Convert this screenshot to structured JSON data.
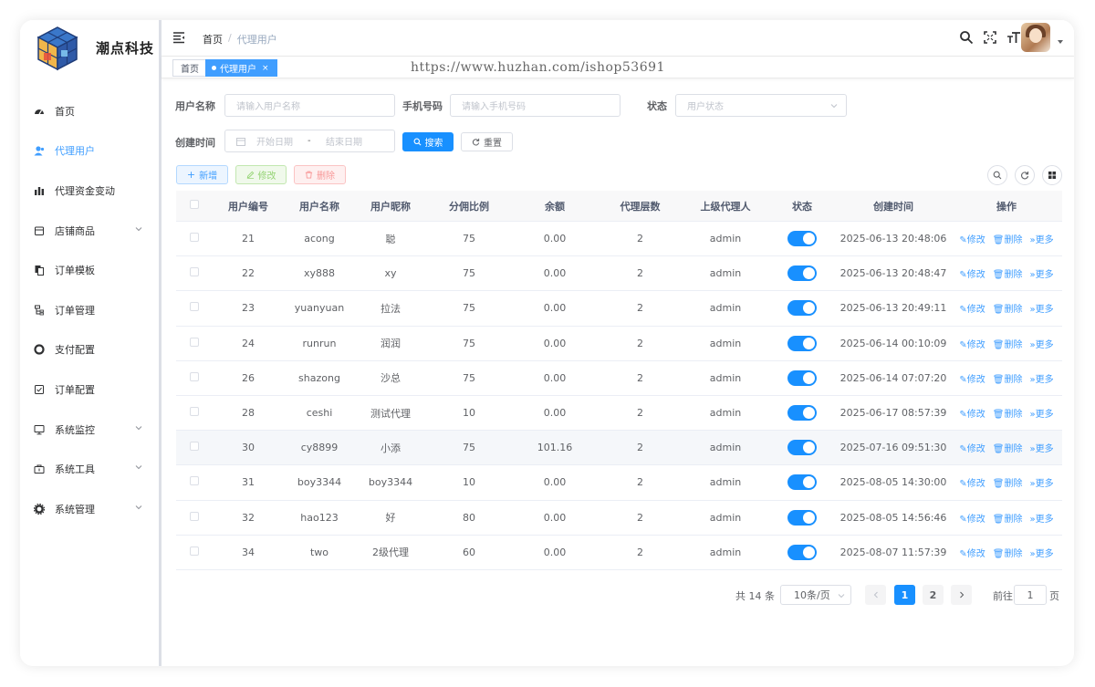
{
  "sidebar": {
    "brand": "潮点科技",
    "items": [
      {
        "label": "首页",
        "icon": "dashboard-icon"
      },
      {
        "label": "代理用户",
        "icon": "user-icon",
        "active": true
      },
      {
        "label": "代理资金变动",
        "icon": "bar-chart-icon"
      },
      {
        "label": "店铺商品",
        "icon": "shop-icon",
        "expandable": true
      },
      {
        "label": "订单模板",
        "icon": "copy-icon"
      },
      {
        "label": "订单管理",
        "icon": "tree-icon"
      },
      {
        "label": "支付配置",
        "icon": "circle-icon"
      },
      {
        "label": "订单配置",
        "icon": "checkbox-icon"
      },
      {
        "label": "系统监控",
        "icon": "monitor-icon",
        "expandable": true
      },
      {
        "label": "系统工具",
        "icon": "toolbox-icon",
        "expandable": true
      },
      {
        "label": "系统管理",
        "icon": "gear-icon",
        "expandable": true
      }
    ]
  },
  "header": {
    "breadcrumb_home": "首页",
    "breadcrumb_sep": "/",
    "breadcrumb_current": "代理用户"
  },
  "tags": {
    "home": "首页",
    "active": "代理用户",
    "close": "×"
  },
  "watermark": "https://www.huzhan.com/ishop53691",
  "search": {
    "username_label": "用户名称",
    "username_placeholder": "请输入用户名称",
    "phone_label": "手机号码",
    "phone_placeholder": "请输入手机号码",
    "status_label": "状态",
    "status_placeholder": "用户状态",
    "created_label": "创建时间",
    "start_placeholder": "开始日期",
    "range_sep": "-",
    "end_placeholder": "结束日期",
    "search_btn": "搜索",
    "reset_btn": "重置"
  },
  "toolbar": {
    "add": "新增",
    "edit": "修改",
    "delete": "删除"
  },
  "table": {
    "columns": [
      "用户编号",
      "用户名称",
      "用户昵称",
      "分佣比例",
      "余额",
      "代理层数",
      "上级代理人",
      "状态",
      "创建时间",
      "操作"
    ],
    "rows": [
      {
        "id": "21",
        "username": "acong",
        "nickname": "聪",
        "ratio": "75",
        "balance": "0.00",
        "level": "2",
        "parent": "admin",
        "enabled": true,
        "created": "2025-06-13 20:48:06"
      },
      {
        "id": "22",
        "username": "xy888",
        "nickname": "xy",
        "ratio": "75",
        "balance": "0.00",
        "level": "2",
        "parent": "admin",
        "enabled": true,
        "created": "2025-06-13 20:48:47"
      },
      {
        "id": "23",
        "username": "yuanyuan",
        "nickname": "拉法",
        "ratio": "75",
        "balance": "0.00",
        "level": "2",
        "parent": "admin",
        "enabled": true,
        "created": "2025-06-13 20:49:11"
      },
      {
        "id": "24",
        "username": "runrun",
        "nickname": "润润",
        "ratio": "75",
        "balance": "0.00",
        "level": "2",
        "parent": "admin",
        "enabled": true,
        "created": "2025-06-14 00:10:09"
      },
      {
        "id": "26",
        "username": "shazong",
        "nickname": "沙总",
        "ratio": "75",
        "balance": "0.00",
        "level": "2",
        "parent": "admin",
        "enabled": true,
        "created": "2025-06-14 07:07:20"
      },
      {
        "id": "28",
        "username": "ceshi",
        "nickname": "测试代理",
        "ratio": "10",
        "balance": "0.00",
        "level": "2",
        "parent": "admin",
        "enabled": true,
        "created": "2025-06-17 08:57:39"
      },
      {
        "id": "30",
        "username": "cy8899",
        "nickname": "小添",
        "ratio": "75",
        "balance": "101.16",
        "level": "2",
        "parent": "admin",
        "enabled": true,
        "created": "2025-07-16 09:51:30",
        "hover": true
      },
      {
        "id": "31",
        "username": "boy3344",
        "nickname": "boy3344",
        "ratio": "10",
        "balance": "0.00",
        "level": "2",
        "parent": "admin",
        "enabled": true,
        "created": "2025-08-05 14:30:00"
      },
      {
        "id": "32",
        "username": "hao123",
        "nickname": "好",
        "ratio": "80",
        "balance": "0.00",
        "level": "2",
        "parent": "admin",
        "enabled": true,
        "created": "2025-08-05 14:56:46"
      },
      {
        "id": "34",
        "username": "two",
        "nickname": "2级代理",
        "ratio": "60",
        "balance": "0.00",
        "level": "2",
        "parent": "admin",
        "enabled": true,
        "created": "2025-08-07 11:57:39"
      }
    ],
    "op_edit": "修改",
    "op_delete": "删除",
    "op_more": "更多"
  },
  "pagination": {
    "total": "共 14 条",
    "page_size": "10条/页",
    "pages": [
      "1",
      "2"
    ],
    "current": "1",
    "goto_label": "前往",
    "goto_value": "1",
    "goto_suffix": "页"
  },
  "colors": {
    "primary": "#1890ff",
    "link": "#409eff"
  }
}
